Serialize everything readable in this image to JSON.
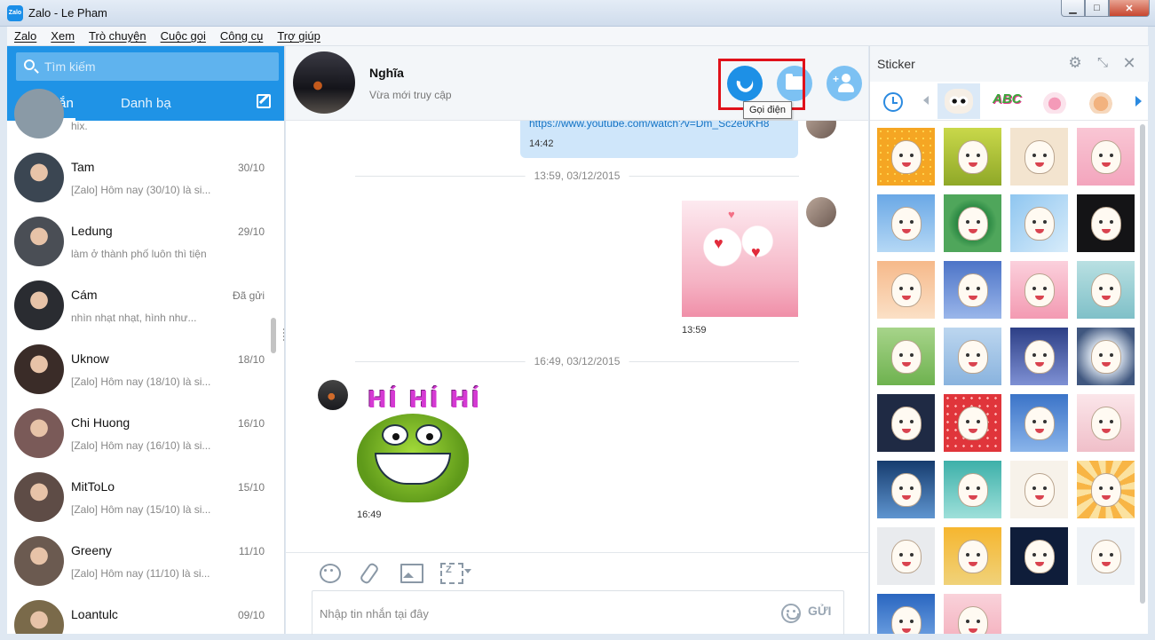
{
  "window": {
    "logo_text": "Zalo",
    "title": "Zalo - Le Pham",
    "minimize_label": "▁",
    "maximize_label": "□",
    "close_label": "✕"
  },
  "menu": [
    "Zalo",
    "Xem",
    "Trò chuyện",
    "Cuộc gọi",
    "Công cụ",
    "Trợ giúp"
  ],
  "sidebar": {
    "search_placeholder": "Tìm kiếm",
    "tab_messages": "Tin nhắn",
    "tab_contacts": "Danh bạ",
    "partial_preview": "hix.",
    "conversations": [
      {
        "name": "Tam",
        "date": "30/10",
        "preview": "[Zalo] Hôm nay (30/10) là si...",
        "color": "#3b4652"
      },
      {
        "name": "Ledung",
        "date": "29/10",
        "preview": "làm ở thành phố luôn thì tiện",
        "color": "#4a4e55"
      },
      {
        "name": "Cám",
        "date": "Đã gửi",
        "preview": "nhìn nhạt nhạt, hình như...",
        "color": "#2a2c31"
      },
      {
        "name": "Uknow",
        "date": "18/10",
        "preview": "[Zalo] Hôm nay (18/10) là si...",
        "color": "#3a2c28"
      },
      {
        "name": "Chi Huong",
        "date": "16/10",
        "preview": "[Zalo] Hôm nay (16/10) là si...",
        "color": "#7a5a58"
      },
      {
        "name": "MitToLo",
        "date": "15/10",
        "preview": "[Zalo] Hôm nay (15/10) là si...",
        "color": "#5e4c46"
      },
      {
        "name": "Greeny",
        "date": "11/10",
        "preview": "[Zalo] Hôm nay (11/10) là si...",
        "color": "#6b5a50"
      },
      {
        "name": "Loantulc",
        "date": "09/10",
        "preview": "",
        "color": "#7a6a4a"
      }
    ]
  },
  "chat": {
    "contact_name": "Nghĩa",
    "contact_status": "Vừa mới truy cập",
    "call_tooltip": "Gọi điện",
    "messages": {
      "link_text": "https://www.youtube.com/watch?v=Dm_Sc2e0KH8",
      "link_time": "14:42",
      "divider_1": "13:59, 03/12/2015",
      "sticker_1_time": "13:59",
      "divider_2": "16:49, 03/12/2015",
      "sticker_2_caption": "HÍ HÍ HÍ",
      "sticker_2_time": "16:49"
    },
    "input_placeholder": "Nhập tin nhắn tại đây",
    "send_label": "GỬI",
    "capture_glyph": "Z"
  },
  "sticker_panel": {
    "title": "Sticker",
    "gear_glyph": "⚙",
    "collapse_glyph": "⤡",
    "close_glyph": "✕",
    "abc_label": "ABC"
  },
  "colors": {
    "accent": "#1f93e6",
    "highlight": "#e0111a"
  }
}
